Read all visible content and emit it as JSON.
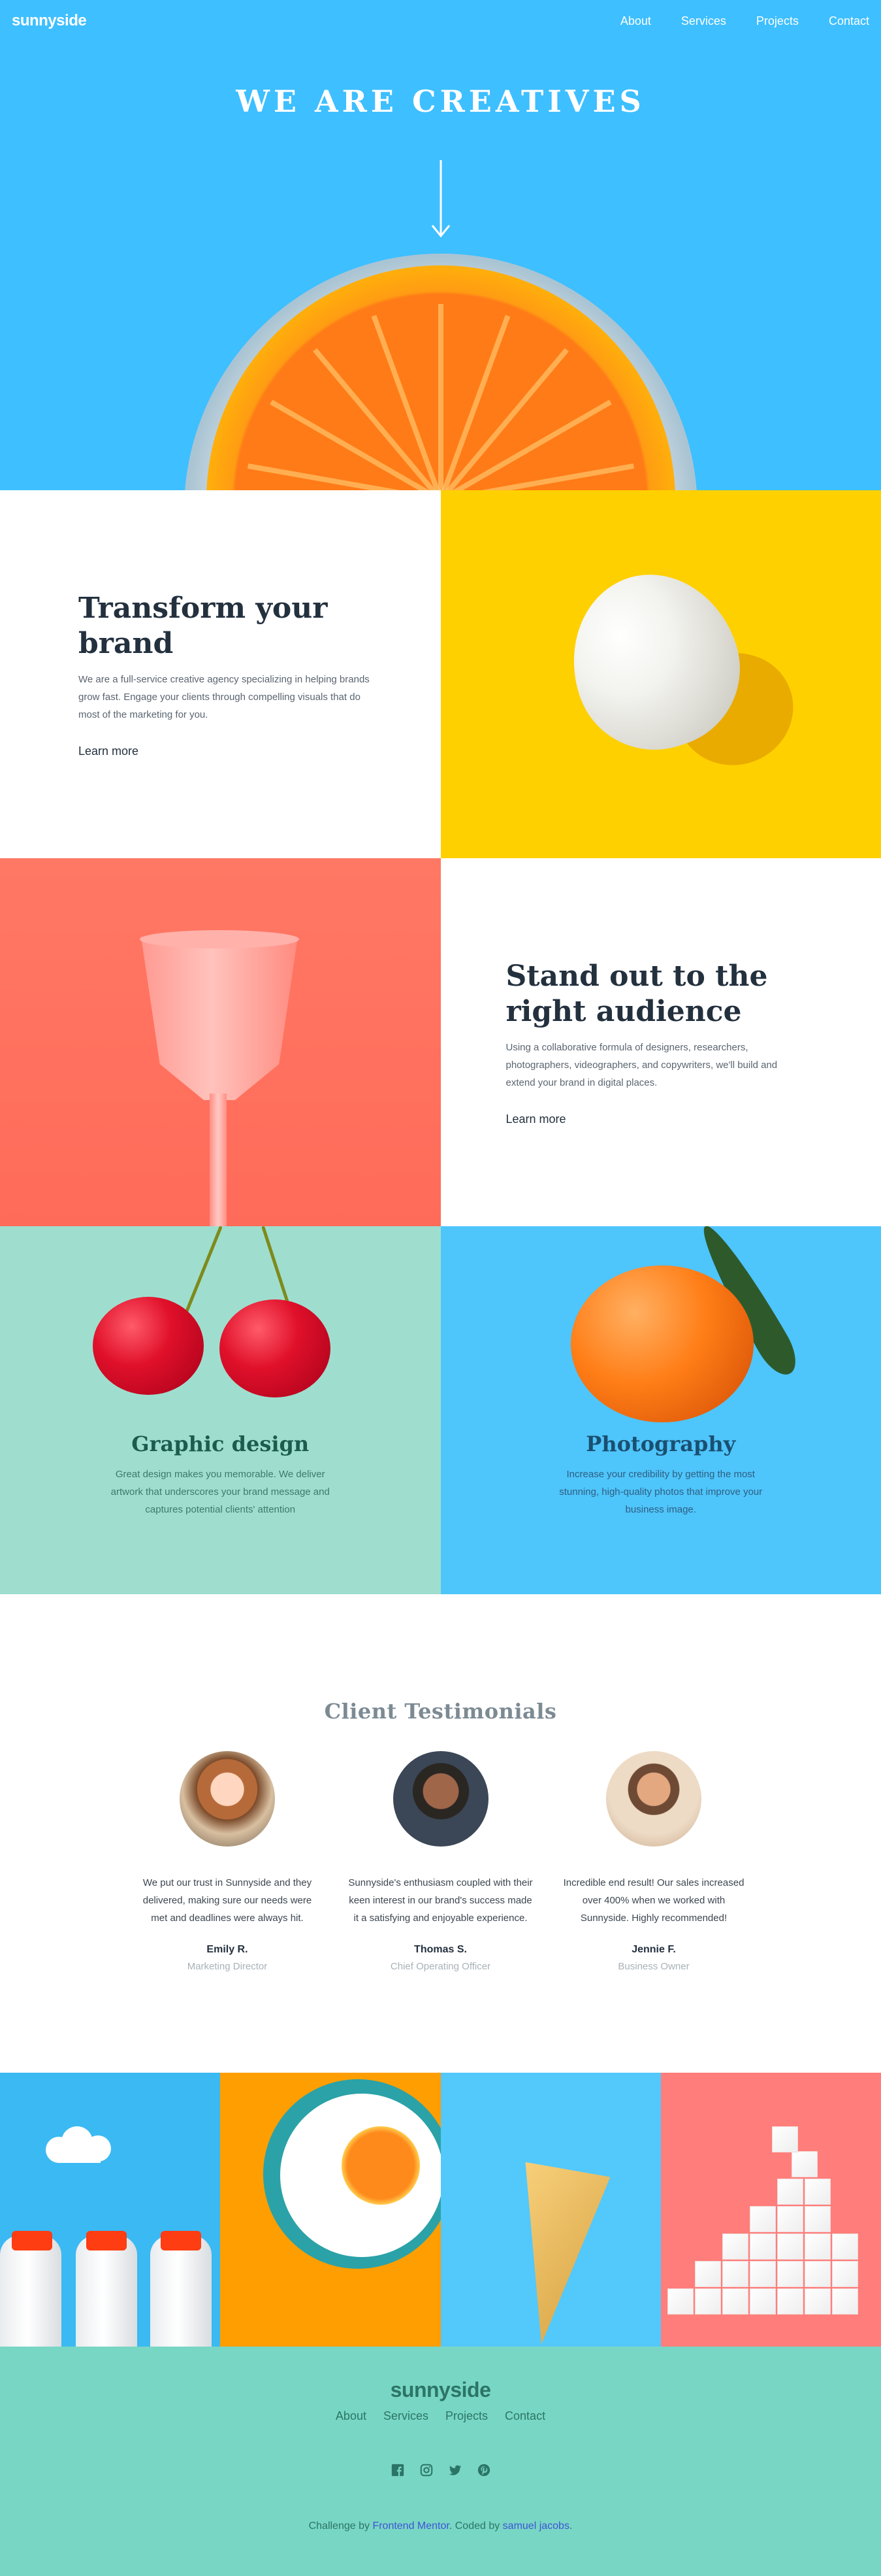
{
  "header": {
    "logo": "sunnyside",
    "nav": [
      "About",
      "Services",
      "Projects",
      "Contact"
    ]
  },
  "hero": {
    "title": "WE ARE CREATIVES"
  },
  "features": [
    {
      "title": "Transform your brand",
      "body": "We are a full-service creative agency specializing in helping brands grow fast. Engage your clients through compelling visuals that do most of the marketing for you.",
      "link": "Learn more",
      "underline_color": "#fad400"
    },
    {
      "title": "Stand out to the right audience",
      "body": "Using a collaborative formula of designers, researchers, photographers, videographers, and copywriters, we'll build and extend your brand in digital places.",
      "link": "Learn more",
      "underline_color": "#fe7766"
    }
  ],
  "services": [
    {
      "title": "Graphic design",
      "body": "Great design makes you memorable. We deliver artwork that underscores your brand message and captures potential clients' attention"
    },
    {
      "title": "Photography",
      "body": "Increase your credibility by getting the most stunning, high-quality photos that improve your business image."
    }
  ],
  "testimonials": {
    "title": "Client Testimonials",
    "items": [
      {
        "quote": "We put our trust in Sunnyside and they delivered, making sure our needs were met and deadlines were always hit.",
        "name": "Emily R.",
        "role": "Marketing Director"
      },
      {
        "quote": "Sunnyside's enthusiasm coupled with their keen interest in our brand's success made it a satisfying and enjoyable experience.",
        "name": "Thomas S.",
        "role": "Chief Operating Officer"
      },
      {
        "quote": "Incredible end result! Our sales increased over 400% when we worked with Sunnyside. Highly recommended!",
        "name": "Jennie F.",
        "role": "Business Owner"
      }
    ]
  },
  "footer": {
    "logo": "sunnyside",
    "nav": [
      "About",
      "Services",
      "Projects",
      "Contact"
    ],
    "social_icons": [
      "facebook-icon",
      "instagram-icon",
      "twitter-icon",
      "pinterest-icon"
    ],
    "attribution_prefix": "Challenge by ",
    "attribution_link1": "Frontend Mentor",
    "attribution_middle": ". Coded by ",
    "attribution_link2": "samuel jacobs",
    "attribution_suffix": "."
  },
  "colors": {
    "hero_bg": "#3ebfff",
    "yellow": "#ffd000",
    "coral": "#ff7864",
    "mint": "#9fdecf",
    "footer_bg": "#78d6c4"
  }
}
